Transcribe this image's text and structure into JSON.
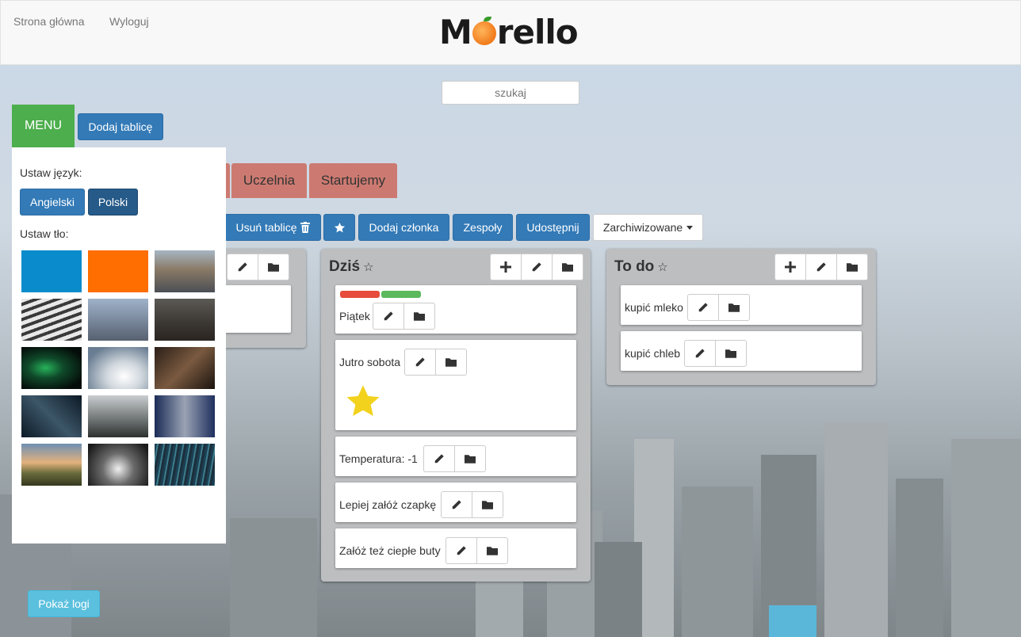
{
  "nav": {
    "home": "Strona główna",
    "logout": "Wyloguj"
  },
  "logo": {
    "text_a": "M",
    "text_b": "rello"
  },
  "search": {
    "placeholder": "szukaj"
  },
  "menu": {
    "label": "MENU",
    "add_board": "Dodaj tablicę"
  },
  "sidebar": {
    "language_label": "Ustaw język:",
    "languages": [
      "Angielski",
      "Polski"
    ],
    "selected_language": "Polski",
    "background_label": "Ustaw tło:",
    "backgrounds": [
      "blue",
      "orange",
      "city-aerial",
      "building-facade",
      "city-skyline",
      "night-city",
      "aurora",
      "clouds",
      "curved-wall",
      "glass-towers",
      "misty-hills",
      "skyscrapers",
      "mountain-sunset",
      "towers-up",
      "light-wall"
    ]
  },
  "tabs": [
    "Uczelnia",
    "Startujemy"
  ],
  "toolbar": {
    "delete_board": "Usuń tablicę",
    "add_member": "Dodaj członka",
    "teams": "Zespoły",
    "share": "Udostępnij",
    "archived": "Zarchiwizowane"
  },
  "lists": [
    {
      "title": "Dziś",
      "cards": [
        {
          "text": "Piątek",
          "labels": [
            "#e74c3c",
            "#5cb85c"
          ]
        },
        {
          "text": "Jutro sobota",
          "sticker": "star"
        },
        {
          "text": "Temperatura: -1"
        },
        {
          "text": "Lepiej załóż czapkę"
        },
        {
          "text": "Załóż też ciepłe buty"
        }
      ]
    },
    {
      "title": "To do",
      "cards": [
        {
          "text": "kupić mleko"
        },
        {
          "text": "kupić chleb"
        }
      ]
    }
  ],
  "show_logs": "Pokaż logi",
  "icons": {
    "star": "star-icon",
    "plus": "plus-icon",
    "pencil": "pencil-icon",
    "folder": "folder-icon",
    "trash": "trash-icon",
    "caret": "caret-down-icon"
  },
  "colors": {
    "primary": "#337ab7",
    "success": "#4cae4c",
    "tab": "#cc7a71",
    "info": "#5bc0de"
  }
}
